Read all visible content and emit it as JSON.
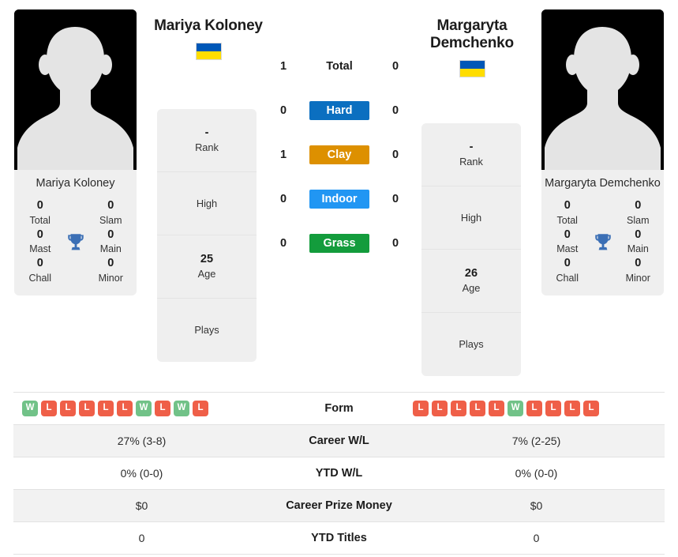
{
  "players": {
    "left": {
      "name": "Mariya Koloney",
      "card_name": "Mariya Koloney",
      "flag": "ukraine-flag",
      "titles": {
        "total_value": "0",
        "total_label": "Total",
        "slam_value": "0",
        "slam_label": "Slam",
        "mast_value": "0",
        "mast_label": "Mast",
        "main_value": "0",
        "main_label": "Main",
        "chall_value": "0",
        "chall_label": "Chall",
        "minor_value": "0",
        "minor_label": "Minor"
      },
      "info": {
        "rank_value": "-",
        "rank_label": "Rank",
        "high_value": "",
        "high_label": "High",
        "age_value": "25",
        "age_label": "Age",
        "plays_value": "",
        "plays_label": "Plays"
      },
      "surface_wins": {
        "total": "1",
        "hard": "0",
        "clay": "1",
        "indoor": "0",
        "grass": "0"
      },
      "stats": {
        "form": [
          "W",
          "L",
          "L",
          "L",
          "L",
          "L",
          "W",
          "L",
          "W",
          "L"
        ],
        "career_wl": "27% (3-8)",
        "ytd_wl": "0% (0-0)",
        "career_prize_money": "$0",
        "ytd_titles": "0"
      }
    },
    "right": {
      "name": "Margaryta Demchenko",
      "card_name": "Margaryta Demchenko",
      "flag": "ukraine-flag",
      "titles": {
        "total_value": "0",
        "total_label": "Total",
        "slam_value": "0",
        "slam_label": "Slam",
        "mast_value": "0",
        "mast_label": "Mast",
        "main_value": "0",
        "main_label": "Main",
        "chall_value": "0",
        "chall_label": "Chall",
        "minor_value": "0",
        "minor_label": "Minor"
      },
      "info": {
        "rank_value": "-",
        "rank_label": "Rank",
        "high_value": "",
        "high_label": "High",
        "age_value": "26",
        "age_label": "Age",
        "plays_value": "",
        "plays_label": "Plays"
      },
      "surface_wins": {
        "total": "0",
        "hard": "0",
        "clay": "0",
        "indoor": "0",
        "grass": "0"
      },
      "stats": {
        "form": [
          "L",
          "L",
          "L",
          "L",
          "L",
          "W",
          "L",
          "L",
          "L",
          "L"
        ],
        "career_wl": "7% (2-25)",
        "ytd_wl": "0% (0-0)",
        "career_prize_money": "$0",
        "ytd_titles": "0"
      }
    }
  },
  "surfaces": {
    "total_label": "Total",
    "hard_label": "Hard",
    "clay_label": "Clay",
    "indoor_label": "Indoor",
    "grass_label": "Grass"
  },
  "table_labels": {
    "form": "Form",
    "career_wl": "Career W/L",
    "ytd_wl": "YTD W/L",
    "career_prize_money": "Career Prize Money",
    "ytd_titles": "YTD Titles"
  },
  "colors": {
    "hard": "#0b6fc0",
    "clay": "#dd9000",
    "indoor": "#2196f3",
    "grass": "#139c3c",
    "win_badge": "#71c288",
    "loss_badge": "#ef5f48",
    "trophy": "#3b6fb5",
    "flag_blue": "#0057B7",
    "flag_yellow": "#FFDD00",
    "card_bg": "#efefef",
    "stripe_bg": "#f2f2f2"
  }
}
